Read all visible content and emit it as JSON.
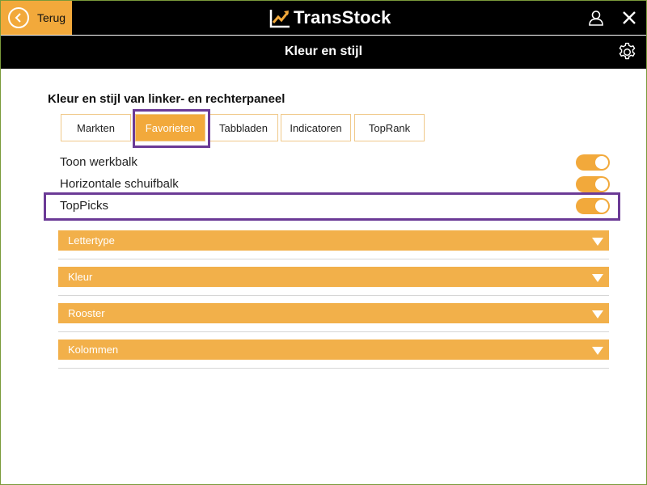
{
  "header": {
    "back_label": "Terug",
    "app_name": "TransStock",
    "icons": [
      "back-icon",
      "logo-chart-icon",
      "user-icon",
      "close-icon"
    ]
  },
  "titlebar": {
    "title": "Kleur en stijl",
    "settings_icon": "gear-icon"
  },
  "section": {
    "heading": "Kleur en stijl van linker- en rechterpaneel",
    "tabs": [
      {
        "label": "Markten",
        "active": false
      },
      {
        "label": "Favorieten",
        "active": true
      },
      {
        "label": "Tabbladen",
        "active": false
      },
      {
        "label": "Indicatoren",
        "active": false
      },
      {
        "label": "TopRank",
        "active": false
      }
    ],
    "toggles": [
      {
        "label": "Toon werkbalk",
        "on": true
      },
      {
        "label": "Horizontale schuifbalk",
        "on": true
      },
      {
        "label": "TopPicks",
        "on": true
      }
    ],
    "accordions": [
      {
        "label": "Lettertype"
      },
      {
        "label": "Kleur"
      },
      {
        "label": "Rooster"
      },
      {
        "label": "Kolommen"
      }
    ]
  },
  "colors": {
    "accent": "#f2a93b",
    "bar": "#000000",
    "highlight": "#6b3a96"
  }
}
